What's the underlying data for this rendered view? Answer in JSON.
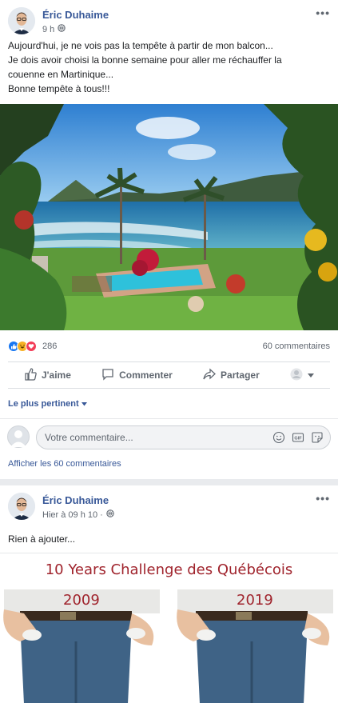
{
  "post1": {
    "author": "Éric Duhaime",
    "time": "9 h",
    "text_lines": [
      "Aujourd'hui, je ne vois pas la tempête à partir de mon balcon...",
      "Je dois avoir choisi la bonne semaine pour aller me réchauffer la",
      "couenne en Martinique...",
      "Bonne tempête à tous!!!"
    ],
    "reaction_count": "286",
    "comment_count": "60 commentaires",
    "actions": {
      "like": "J'aime",
      "comment": "Commenter",
      "share": "Partager"
    },
    "sort_label": "Le plus pertinent",
    "comment_placeholder": "Votre commentaire...",
    "view_all": "Afficher les 60 commentaires"
  },
  "post2": {
    "author": "Éric Duhaime",
    "time": "Hier à 09 h 10 ·",
    "text": "Rien à ajouter...",
    "image": {
      "title": "10 Years Challenge des Québécois",
      "year_left": "2009",
      "year_right": "2019"
    }
  },
  "colors": {
    "link": "#385898",
    "like_blue": "#1877f2",
    "love_red": "#f33e58",
    "haha_yellow": "#f7b125",
    "challenge_red": "#a0242d"
  },
  "icons": [
    "like-icon",
    "haha-icon",
    "love-icon",
    "thumbs-up-icon",
    "comment-icon",
    "share-icon",
    "globe-icon",
    "more-icon",
    "emoji-icon",
    "gif-icon",
    "sticker-icon"
  ]
}
